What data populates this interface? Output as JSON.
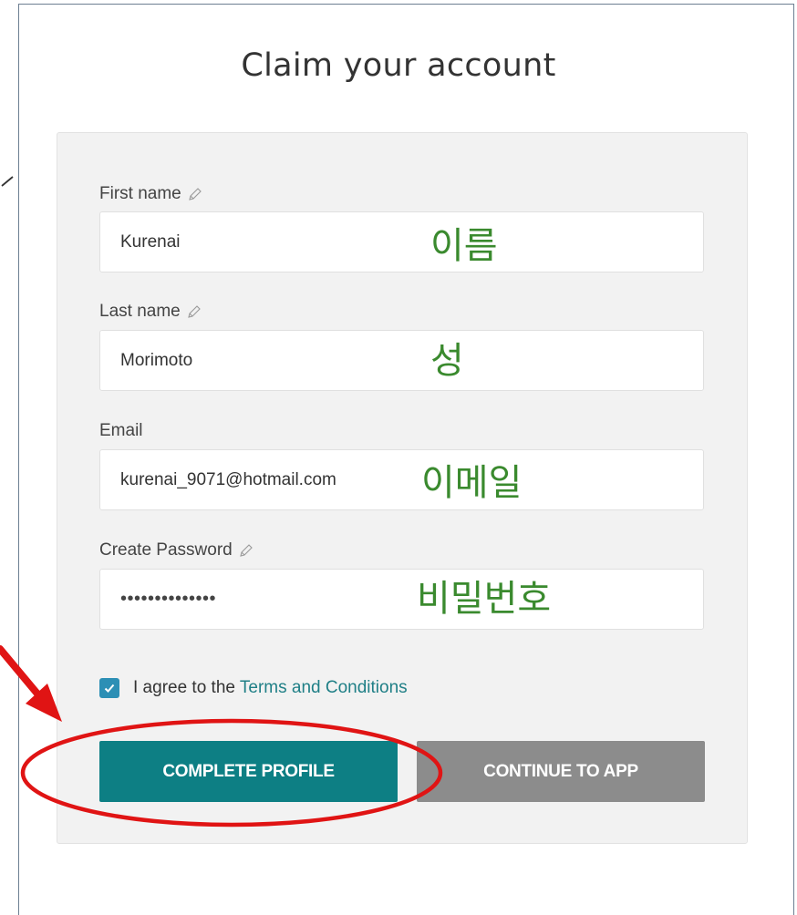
{
  "page": {
    "title": "Claim your account"
  },
  "form": {
    "first_name": {
      "label": "First name",
      "value": "Kurenai",
      "annotation": "이름"
    },
    "last_name": {
      "label": "Last name",
      "value": "Morimoto",
      "annotation": "성"
    },
    "email": {
      "label": "Email",
      "value": "kurenai_9071@hotmail.com",
      "annotation": "이메일"
    },
    "password": {
      "label": "Create Password",
      "value": "••••••••••••••",
      "annotation": "비밀번호"
    },
    "agree": {
      "checked": true,
      "prefix": "I agree to the ",
      "link": "Terms and Conditions"
    }
  },
  "buttons": {
    "complete_profile": "COMPLETE PROFILE",
    "continue_to_app": "CONTINUE TO APP"
  },
  "colors": {
    "primary": "#0d7f84",
    "secondary": "#8c8c8c",
    "annotation_green": "#3a8a2e",
    "annotation_red": "#e01414",
    "checkbox": "#2c8fb5"
  },
  "icons": [
    "pencil-icon",
    "check-icon",
    "chevron-icon",
    "arrow-icon"
  ]
}
